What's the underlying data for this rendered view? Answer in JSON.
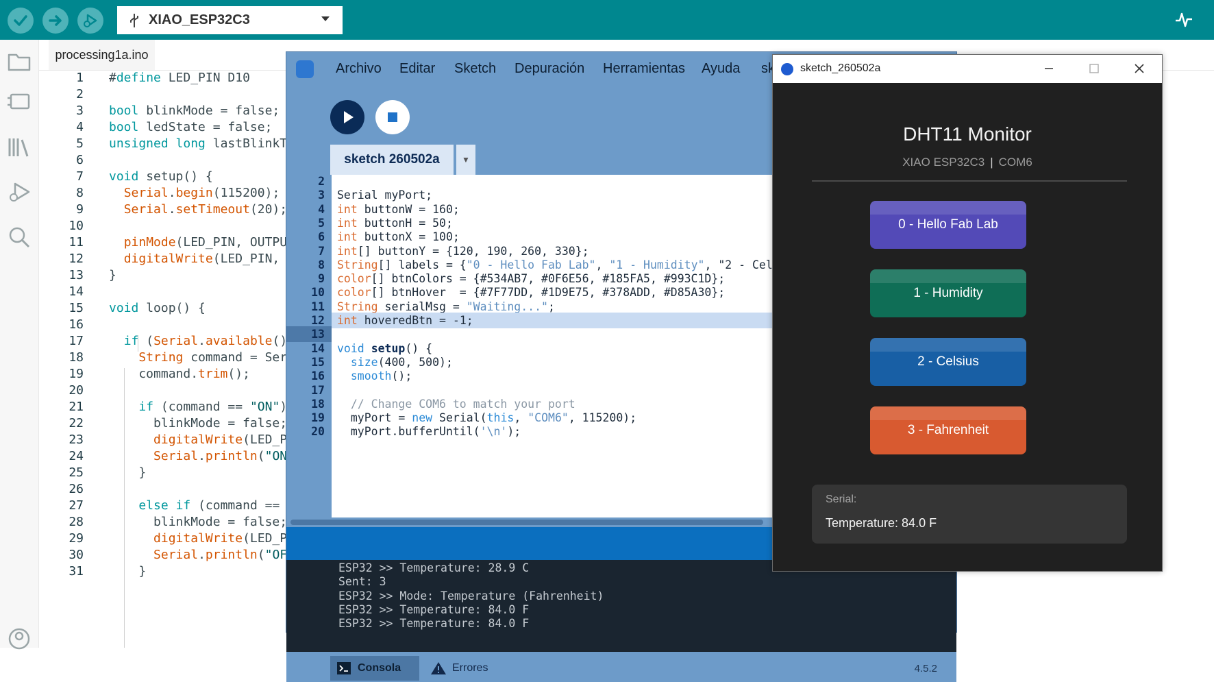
{
  "arduino": {
    "board": "XIAO_ESP32C3",
    "file_tab": "processing1a.ino",
    "lines": [
      {
        "n": "1",
        "t": "#define LED_PIN D10"
      },
      {
        "n": "2",
        "t": ""
      },
      {
        "n": "3",
        "t": "bool blinkMode = false;"
      },
      {
        "n": "4",
        "t": "bool ledState = false;"
      },
      {
        "n": "5",
        "t": "unsigned long lastBlinkT"
      },
      {
        "n": "6",
        "t": ""
      },
      {
        "n": "7",
        "t": "void setup() {"
      },
      {
        "n": "8",
        "t": "  Serial.begin(115200);"
      },
      {
        "n": "9",
        "t": "  Serial.setTimeout(20);"
      },
      {
        "n": "10",
        "t": ""
      },
      {
        "n": "11",
        "t": "  pinMode(LED_PIN, OUTPU"
      },
      {
        "n": "12",
        "t": "  digitalWrite(LED_PIN,"
      },
      {
        "n": "13",
        "t": "}"
      },
      {
        "n": "14",
        "t": ""
      },
      {
        "n": "15",
        "t": "void loop() {"
      },
      {
        "n": "16",
        "t": ""
      },
      {
        "n": "17",
        "t": "  if (Serial.available()"
      },
      {
        "n": "18",
        "t": "    String command = Ser"
      },
      {
        "n": "19",
        "t": "    command.trim();"
      },
      {
        "n": "20",
        "t": ""
      },
      {
        "n": "21",
        "t": "    if (command == \"ON\")"
      },
      {
        "n": "22",
        "t": "      blinkMode = false;"
      },
      {
        "n": "23",
        "t": "      digitalWrite(LED_P"
      },
      {
        "n": "24",
        "t": "      Serial.println(\"ON"
      },
      {
        "n": "25",
        "t": "    }"
      },
      {
        "n": "26",
        "t": ""
      },
      {
        "n": "27",
        "t": "    else if (command =="
      },
      {
        "n": "28",
        "t": "      blinkMode = false;"
      },
      {
        "n": "29",
        "t": "      digitalWrite(LED_P"
      },
      {
        "n": "30",
        "t": "      Serial.println(\"OF"
      },
      {
        "n": "31",
        "t": "    }"
      }
    ]
  },
  "processing": {
    "menu": [
      "Archivo",
      "Editar",
      "Sketch",
      "Depuración",
      "Herramientas",
      "Ayuda",
      "sk"
    ],
    "tab": "sketch 260502a",
    "tab_menu": "▼",
    "lines": [
      {
        "n": "2",
        "t": ""
      },
      {
        "n": "3",
        "t": "Serial myPort;"
      },
      {
        "n": "4",
        "t": "int buttonW = 160;"
      },
      {
        "n": "5",
        "t": "int buttonH = 50;"
      },
      {
        "n": "6",
        "t": "int buttonX = 100;"
      },
      {
        "n": "7",
        "t": "int[] buttonY = {120, 190, 260, 330};"
      },
      {
        "n": "8",
        "t": "String[] labels = {\"0 - Hello Fab Lab\", \"1 - Humidity\", \"2 - Cel"
      },
      {
        "n": "9",
        "t": "color[] btnColors = {#534AB7, #0F6E56, #185FA5, #993C1D};"
      },
      {
        "n": "10",
        "t": "color[] btnHover  = {#7F77DD, #1D9E75, #378ADD, #D85A30};"
      },
      {
        "n": "11",
        "t": "String serialMsg = \"Waiting...\";"
      },
      {
        "n": "12",
        "t": "int hoveredBtn = -1;"
      },
      {
        "n": "13",
        "t": ""
      },
      {
        "n": "14",
        "t": "void setup() {"
      },
      {
        "n": "15",
        "t": "  size(400, 500);"
      },
      {
        "n": "16",
        "t": "  smooth();"
      },
      {
        "n": "17",
        "t": ""
      },
      {
        "n": "18",
        "t": "  // Change COM6 to match your port"
      },
      {
        "n": "19",
        "t": "  myPort = new Serial(this, \"COM6\", 115200);"
      },
      {
        "n": "20",
        "t": "  myPort.bufferUntil('\\n');"
      }
    ],
    "console": [
      "ESP32 >> Temperature: 28.9 C",
      "Sent: 3",
      "ESP32 >> Mode: Temperature (Fahrenheit)",
      "ESP32 >> Temperature: 84.0 F",
      "ESP32 >> Temperature: 84.0 F"
    ],
    "console_tab": "Consola",
    "errors_tab": "Errores",
    "version": "4.5.2"
  },
  "sketch_window": {
    "title": "sketch_260502a",
    "heading": "DHT11 Monitor",
    "board": "XIAO ESP32C3",
    "port": "COM6",
    "buttons": [
      {
        "label": "0 - Hello Fab Lab",
        "color": "#534AB7"
      },
      {
        "label": "1 - Humidity",
        "color": "#0F6E56"
      },
      {
        "label": "2 - Celsius",
        "color": "#185FA5"
      },
      {
        "label": "3 - Fahrenheit",
        "color": "#D85A30"
      }
    ],
    "serial_label": "Serial:",
    "serial_msg": "Temperature: 84.0 F"
  }
}
